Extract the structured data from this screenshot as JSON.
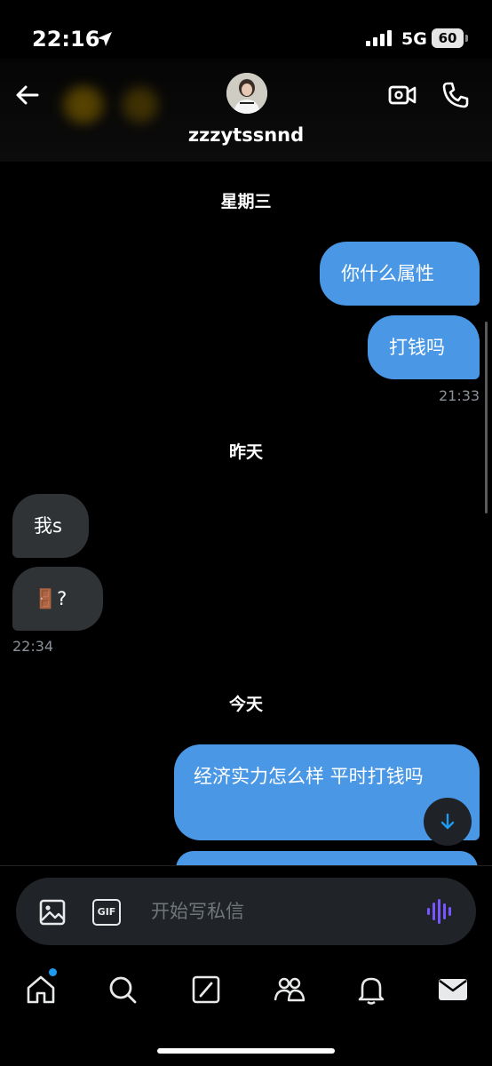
{
  "status_bar": {
    "time": "22:16",
    "network": "5G",
    "battery": "60",
    "icons": [
      "location-arrow-icon",
      "signal-bars-icon",
      "battery-icon"
    ]
  },
  "header": {
    "username": "zzzytssnnd",
    "icons": [
      "back-arrow-icon",
      "avatar",
      "video-call-icon",
      "phone-icon"
    ]
  },
  "messages": {
    "day1": "星期三",
    "m1": "你什么属性",
    "m2": "打钱吗",
    "t1": "21:33",
    "day2": "昨天",
    "m3": "我s",
    "m4_emoji": "🚪",
    "m4_text": "?",
    "t2": "22:34",
    "day3": "今天",
    "m5": "经济实力怎么样 平时打钱吗"
  },
  "composer": {
    "placeholder": "开始写私信",
    "gif_label": "GIF",
    "icons": [
      "image-icon",
      "gif-icon",
      "voice-message-icon"
    ]
  },
  "tabbar": {
    "items": [
      "home-icon",
      "search-icon",
      "grok-icon",
      "communities-icon",
      "notifications-icon",
      "messages-icon"
    ],
    "active": "messages-icon"
  },
  "colors": {
    "background": "#000000",
    "outgoing_bubble": "#4a98e5",
    "incoming_bubble": "#2f3336",
    "accent": "#1d9bf0",
    "voice_accent": "#7856ff"
  }
}
